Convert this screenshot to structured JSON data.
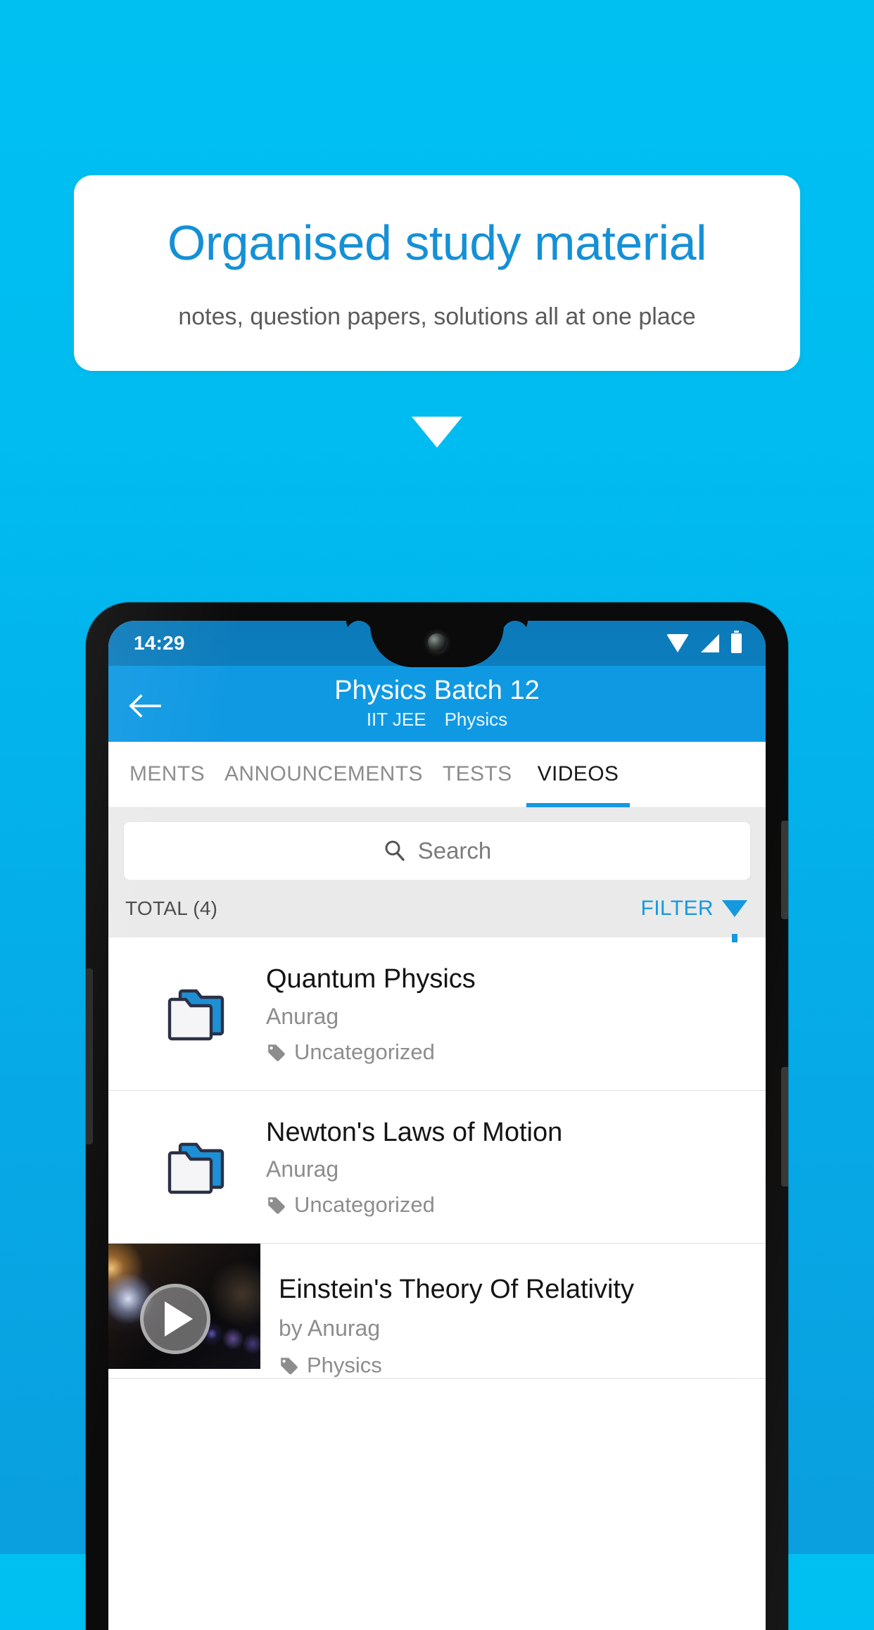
{
  "promo": {
    "title": "Organised study material",
    "subtitle": "notes, question papers, solutions all at one place"
  },
  "colors": {
    "background_top": "#00c0f2",
    "background_bottom": "#0a9fdf",
    "promo_title": "#1590d6",
    "appbar": "#1099e3",
    "statusbar": "#0d7dbe",
    "accent": "#1499e0",
    "folder_blue": "#1e8fd4",
    "folder_outline": "#2c3045"
  },
  "phone": {
    "statusbar": {
      "time": "14:29",
      "icons": [
        "wifi-icon",
        "signal-icon",
        "battery-icon"
      ]
    },
    "appbar": {
      "back_icon": "back-arrow-icon",
      "title": "Physics Batch 12",
      "subtitle_exam": "IIT JEE",
      "subtitle_subject": "Physics"
    },
    "tabs": [
      {
        "label": "MENTS",
        "active": false
      },
      {
        "label": "ANNOUNCEMENTS",
        "active": false
      },
      {
        "label": "TESTS",
        "active": false
      },
      {
        "label": "VIDEOS",
        "active": true
      }
    ],
    "search": {
      "placeholder": "Search",
      "icon": "search-icon"
    },
    "toolbar": {
      "total_label": "TOTAL (4)",
      "filter_label": "FILTER",
      "filter_icon": "funnel-icon"
    },
    "list": [
      {
        "type": "folder",
        "icon": "folder-icon",
        "title": "Quantum Physics",
        "author": "Anurag",
        "tag": "Uncategorized",
        "tag_icon": "tag-icon"
      },
      {
        "type": "folder",
        "icon": "folder-icon",
        "title": "Newton's Laws of Motion",
        "author": "Anurag",
        "tag": "Uncategorized",
        "tag_icon": "tag-icon"
      },
      {
        "type": "video",
        "icon": "video-thumbnail",
        "play_icon": "play-icon",
        "title": "Einstein's Theory Of Relativity",
        "author": "by Anurag",
        "tag": "Physics",
        "tag_icon": "tag-icon"
      }
    ]
  }
}
